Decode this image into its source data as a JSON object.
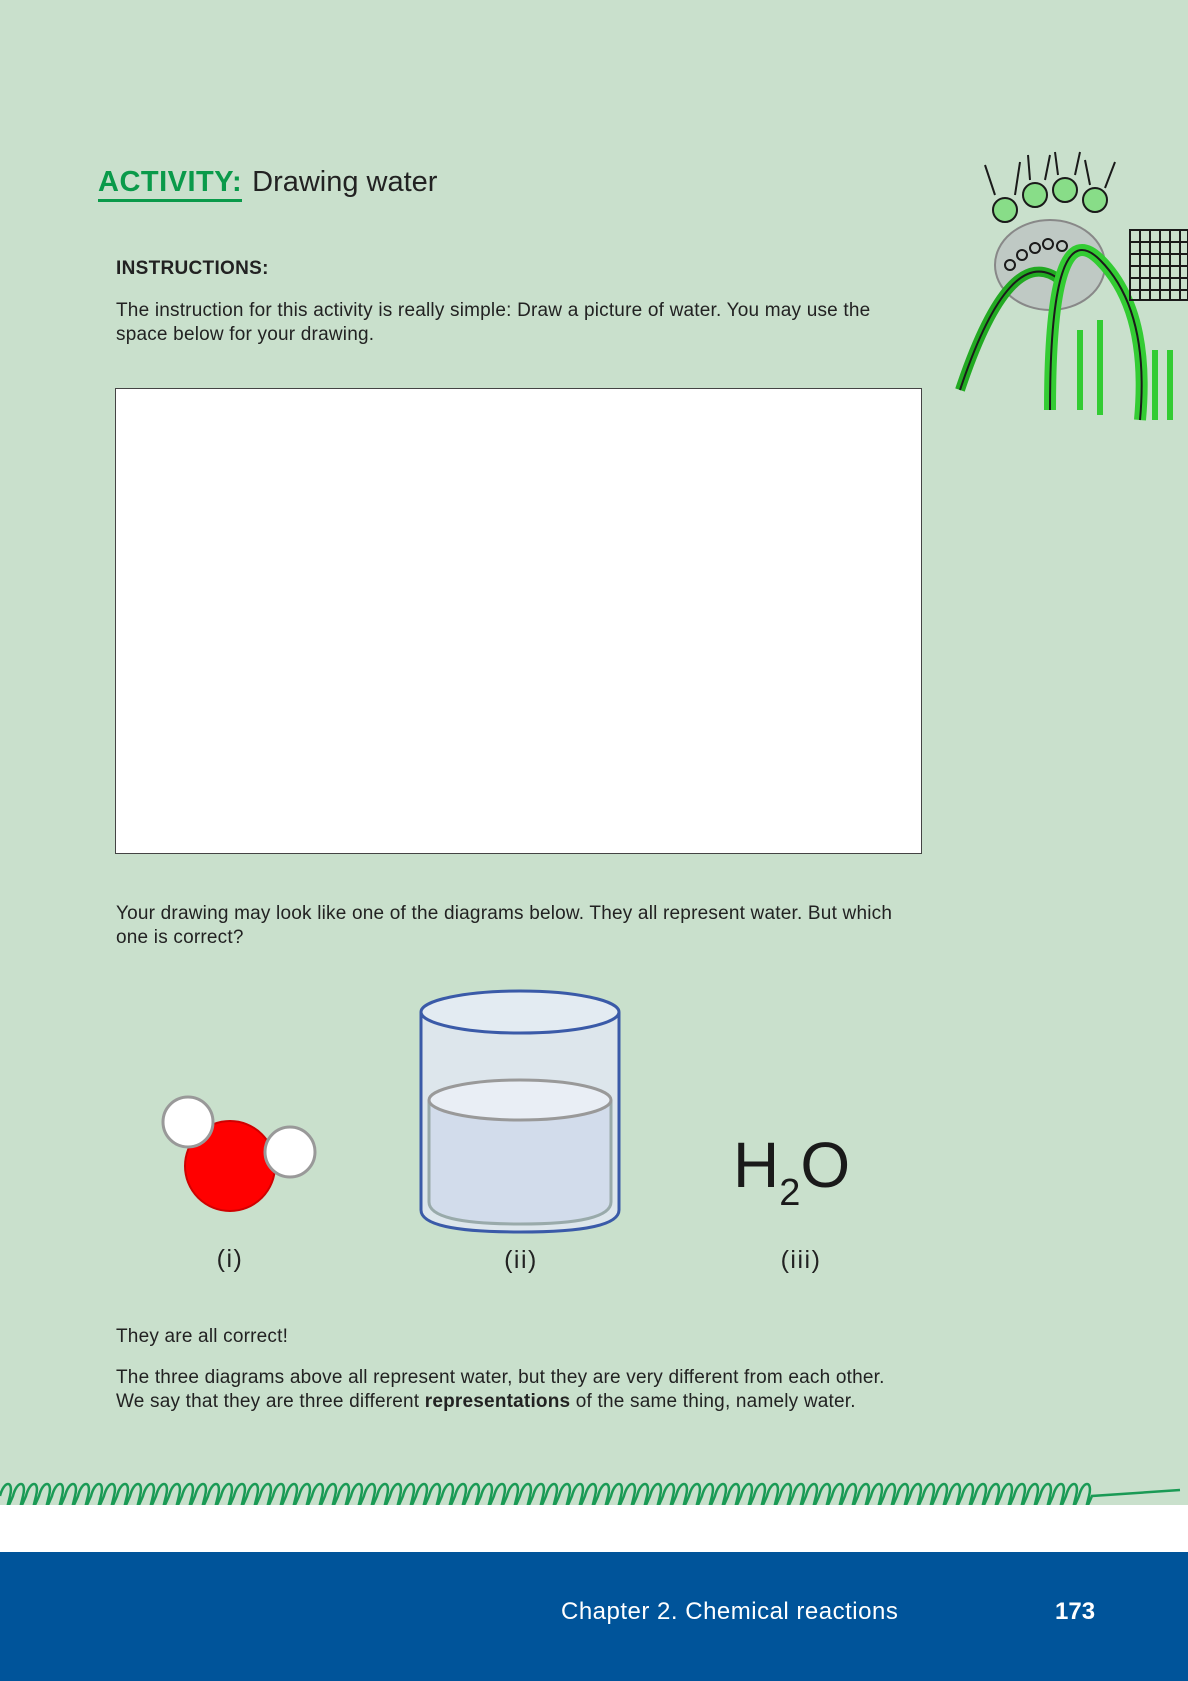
{
  "activity": {
    "label": "ACTIVITY:",
    "title": "Drawing water"
  },
  "instructions": {
    "label": "INSTRUCTIONS:",
    "text": "The instruction for this activity is really simple: Draw a picture of water. You may use the space below for your drawing."
  },
  "intro_text": "Your drawing may look like one of the diagrams below. They all represent water. But which one is correct?",
  "diagrams": [
    {
      "caption": "(i)",
      "icon": "water-molecule-icon"
    },
    {
      "caption": "(ii)",
      "icon": "glass-of-water-icon"
    },
    {
      "caption": "(iii)",
      "icon": "h2o-formula"
    }
  ],
  "formula": {
    "base": "H",
    "subscript": "2",
    "tail": "O"
  },
  "answer_text": "They are all correct!",
  "explanation": {
    "before": "The three diagrams above all represent water, but they are very different from each other. We say that they are three different ",
    "bold": "representations",
    "after": " of the same thing, namely water."
  },
  "footer": {
    "chapter": "Chapter 2.   Chemical reactions",
    "page": "173"
  },
  "colors": {
    "page_background": "#c9e0cc",
    "accent_green": "#0a9a4a",
    "footer_blue": "#00549a"
  }
}
